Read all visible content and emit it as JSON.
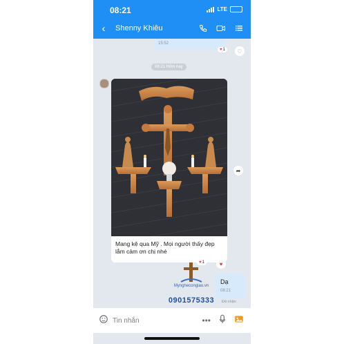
{
  "status_bar": {
    "time": "08:21",
    "network": "LTE"
  },
  "header": {
    "contact_name": "Shenny Khiêu",
    "back_icon": "chevron-left-icon",
    "call_icon": "phone-icon",
    "video_icon": "video-icon",
    "menu_icon": "list-icon"
  },
  "messages": {
    "previous": {
      "time": "15:52",
      "reaction_count": "1"
    },
    "date_separator": "08:21 Hôm nay",
    "photo_message": {
      "caption": "Mang kệ qua Mỹ . Mọi người thấy đẹp lắm cảm ơn chị nhé",
      "reaction_count": "1"
    },
    "reply": {
      "text": "Dạ",
      "time": "08:21",
      "status": "Đã nhận"
    }
  },
  "composer": {
    "placeholder": "Tin nhắn"
  },
  "watermark": {
    "name": "Mynghecongiao.vn",
    "phone": "0901575333"
  },
  "colors": {
    "header": "#1f8ff5",
    "outgoing_bubble": "#d7eafc",
    "background": "#e3e8ee"
  }
}
